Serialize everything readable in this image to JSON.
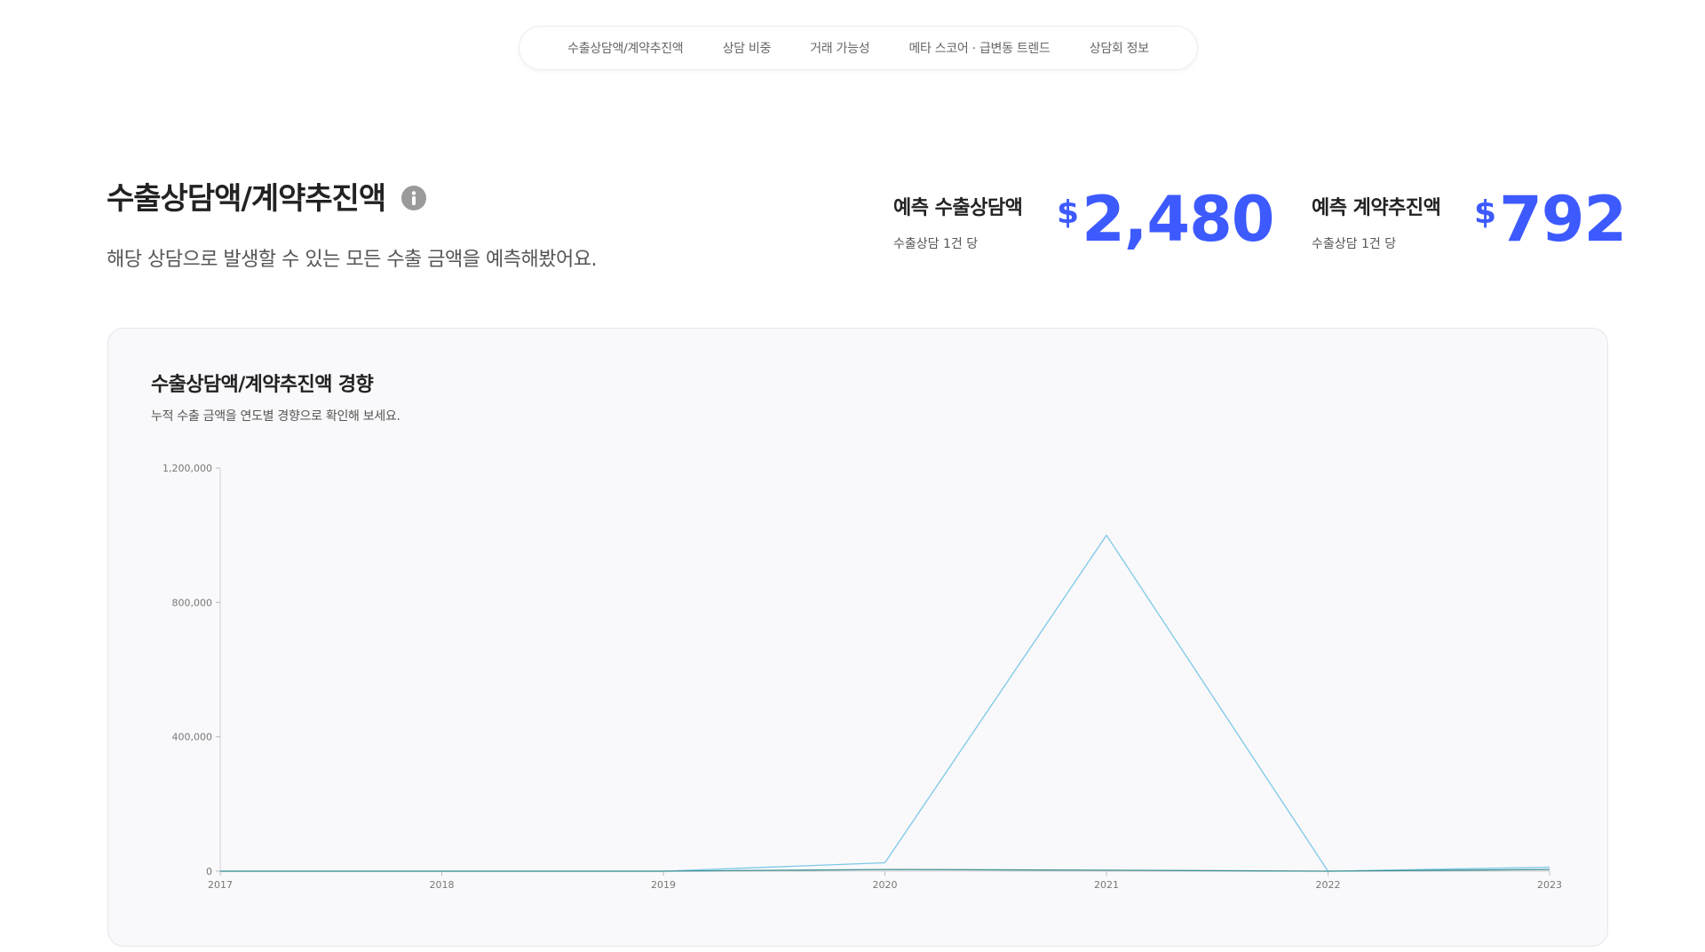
{
  "tabs": [
    {
      "label": "수출상담액/계약추진액"
    },
    {
      "label": "상담 비중"
    },
    {
      "label": "거래 가능성"
    },
    {
      "label": "메타 스코어 · 급변동 트렌드"
    },
    {
      "label": "상담회 정보"
    }
  ],
  "header": {
    "title": "수출상담액/계약추진액",
    "info_icon": "info-icon",
    "subtitle": "해당 상담으로 발생할 수 있는 모든 수출 금액을 예측해봤어요."
  },
  "metrics": [
    {
      "label": "예측 수출상담액",
      "sub": "수출상담 1건 당",
      "currency": "$",
      "value": "2,480"
    },
    {
      "label": "예측 계약추진액",
      "sub": "수출상담 1건 당",
      "currency": "$",
      "value": "792"
    }
  ],
  "colors": {
    "accent": "#3d5afe",
    "series_1": "#7ec8e8",
    "series_2": "#3e8f8f"
  },
  "card": {
    "title": "수출상담액/계약추진액 경향",
    "subtitle": "누적 수출 금액을 연도별 경향으로 확인해 보세요."
  },
  "chart_data": {
    "type": "line",
    "x": [
      "2017",
      "2018",
      "2019",
      "2020",
      "2021",
      "2022",
      "2023"
    ],
    "y_ticks": [
      "1,200,000",
      "800,000",
      "400,000",
      "0"
    ],
    "y_tick_values": [
      1200000,
      800000,
      400000,
      0
    ],
    "ylim": [
      0,
      1200000
    ],
    "grid": false,
    "series": [
      {
        "values": [
          0,
          0,
          0,
          25000,
          1000000,
          0,
          12000
        ]
      },
      {
        "values": [
          0,
          0,
          0,
          5000,
          3000,
          0,
          5000
        ]
      }
    ]
  }
}
